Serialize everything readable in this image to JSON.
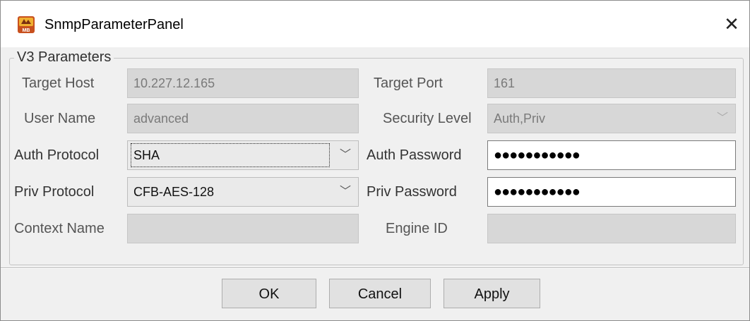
{
  "window": {
    "title": "SnmpParameterPanel",
    "icon": "mibbrowser-app-icon",
    "close_glyph": "✕"
  },
  "group": {
    "title": "V3 Parameters"
  },
  "fields": {
    "target_host": {
      "label": "Target Host",
      "value": "10.227.12.165"
    },
    "target_port": {
      "label": "Target Port",
      "value": "161"
    },
    "user_name": {
      "label": "User Name",
      "value": "advanced"
    },
    "security_level": {
      "label": "Security Level",
      "value": "Auth,Priv"
    },
    "auth_protocol": {
      "label": "Auth Protocol",
      "value": "SHA"
    },
    "auth_password": {
      "label": "Auth Password",
      "value": "●●●●●●●●●●●"
    },
    "priv_protocol": {
      "label": "Priv Protocol",
      "value": "CFB-AES-128"
    },
    "priv_password": {
      "label": "Priv Password",
      "value": "●●●●●●●●●●●"
    },
    "context_name": {
      "label": "Context Name",
      "value": ""
    },
    "engine_id": {
      "label": "Engine ID",
      "value": ""
    }
  },
  "buttons": {
    "ok": "OK",
    "cancel": "Cancel",
    "apply": "Apply"
  },
  "dropdown_glyph": "﹀"
}
